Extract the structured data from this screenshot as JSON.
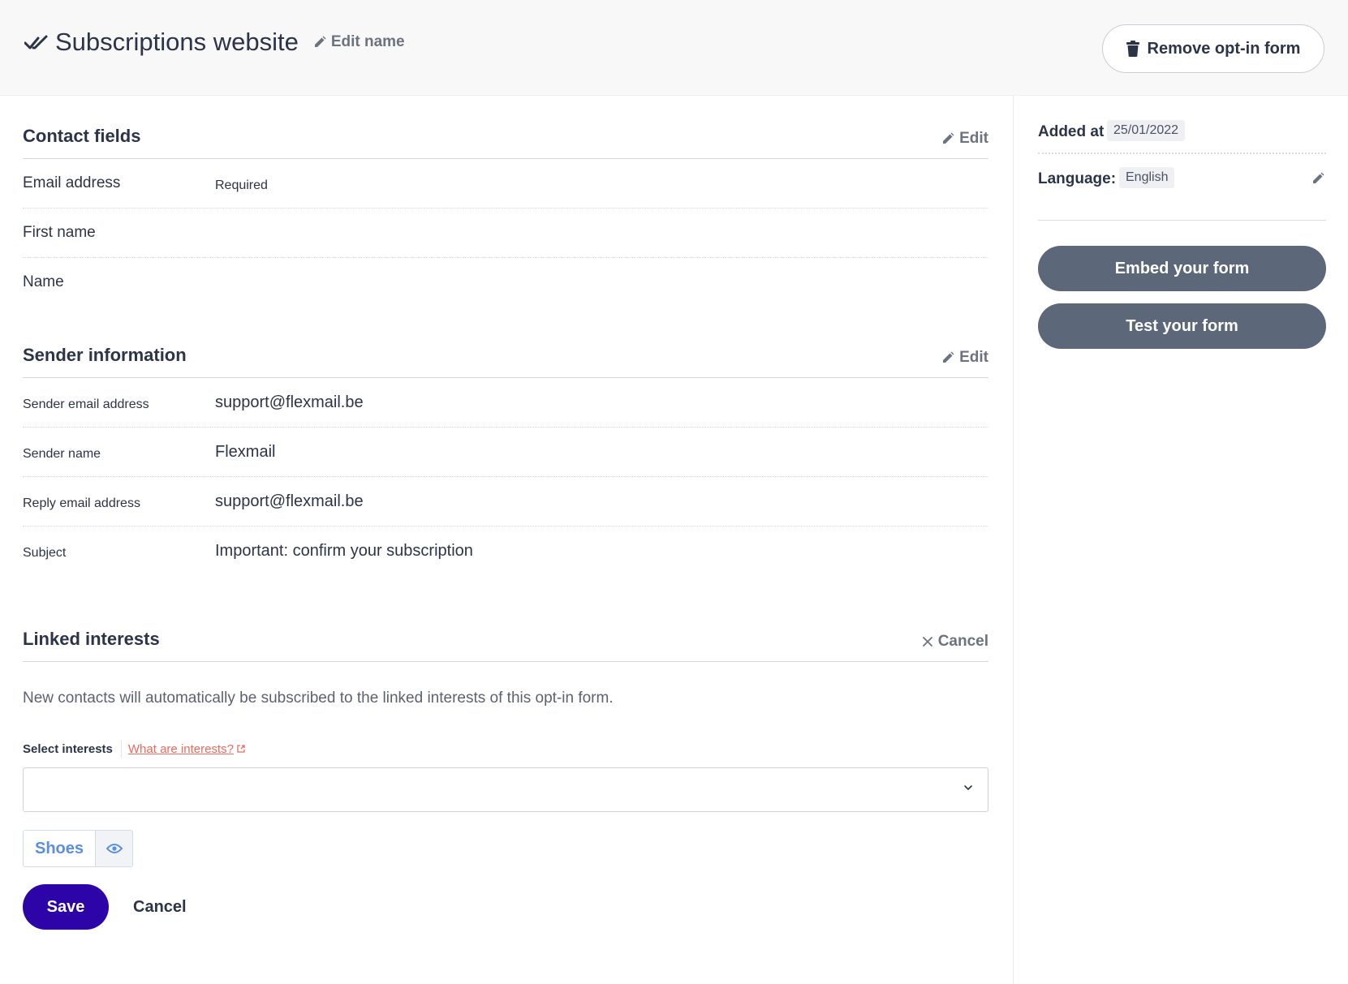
{
  "header": {
    "title": "Subscriptions website",
    "edit_name_label": "Edit name",
    "remove_label": "Remove opt-in form"
  },
  "contact_fields": {
    "title": "Contact fields",
    "edit_label": "Edit",
    "rows": [
      {
        "label": "Email address",
        "meta": "Required"
      },
      {
        "label": "First name",
        "meta": ""
      },
      {
        "label": "Name",
        "meta": ""
      }
    ]
  },
  "sender_info": {
    "title": "Sender information",
    "edit_label": "Edit",
    "rows": [
      {
        "label": "Sender email address",
        "value": "support@flexmail.be"
      },
      {
        "label": "Sender name",
        "value": "Flexmail"
      },
      {
        "label": "Reply email address",
        "value": "support@flexmail.be"
      },
      {
        "label": "Subject",
        "value": "Important: confirm your subscription"
      }
    ]
  },
  "linked_interests": {
    "title": "Linked interests",
    "cancel_label": "Cancel",
    "intro": "New contacts will automatically be subscribed to the linked interests of this opt-in form.",
    "select_label": "Select interests",
    "help_link": "What are interests?",
    "selected_value": "",
    "tags": [
      "Shoes"
    ],
    "save_label": "Save",
    "cancel_button_label": "Cancel"
  },
  "sidebar": {
    "added_label": "Added at",
    "added_date": "25/01/2022",
    "language_label": "Language:",
    "language_value": "English",
    "embed_label": "Embed your form",
    "test_label": "Test your form"
  },
  "colors": {
    "primary": "#2c04a8",
    "secondary_button": "#5c6779",
    "link": "#ea6a5e",
    "tag_text": "#5a8ee0",
    "text": "#2b3448"
  }
}
